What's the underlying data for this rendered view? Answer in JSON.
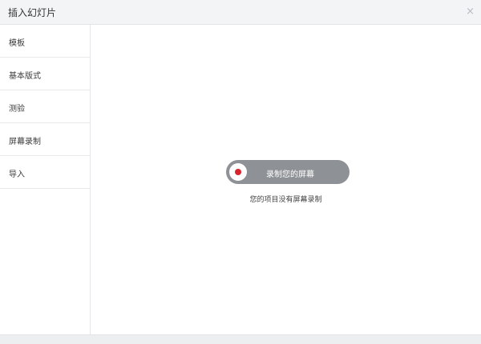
{
  "window": {
    "title": "插入幻灯片",
    "close_glyph": "×"
  },
  "sidebar": {
    "items": [
      {
        "label": "模板"
      },
      {
        "label": "基本版式"
      },
      {
        "label": "测验"
      },
      {
        "label": "屏幕录制"
      },
      {
        "label": "导入"
      }
    ]
  },
  "main": {
    "record_button_label": "录制您的屏幕",
    "empty_message": "您的项目没有屏幕录制"
  },
  "colors": {
    "record_button_bg": "#8e9195",
    "record_dot": "#d9232d",
    "titlebar_bg": "#f3f4f6"
  }
}
